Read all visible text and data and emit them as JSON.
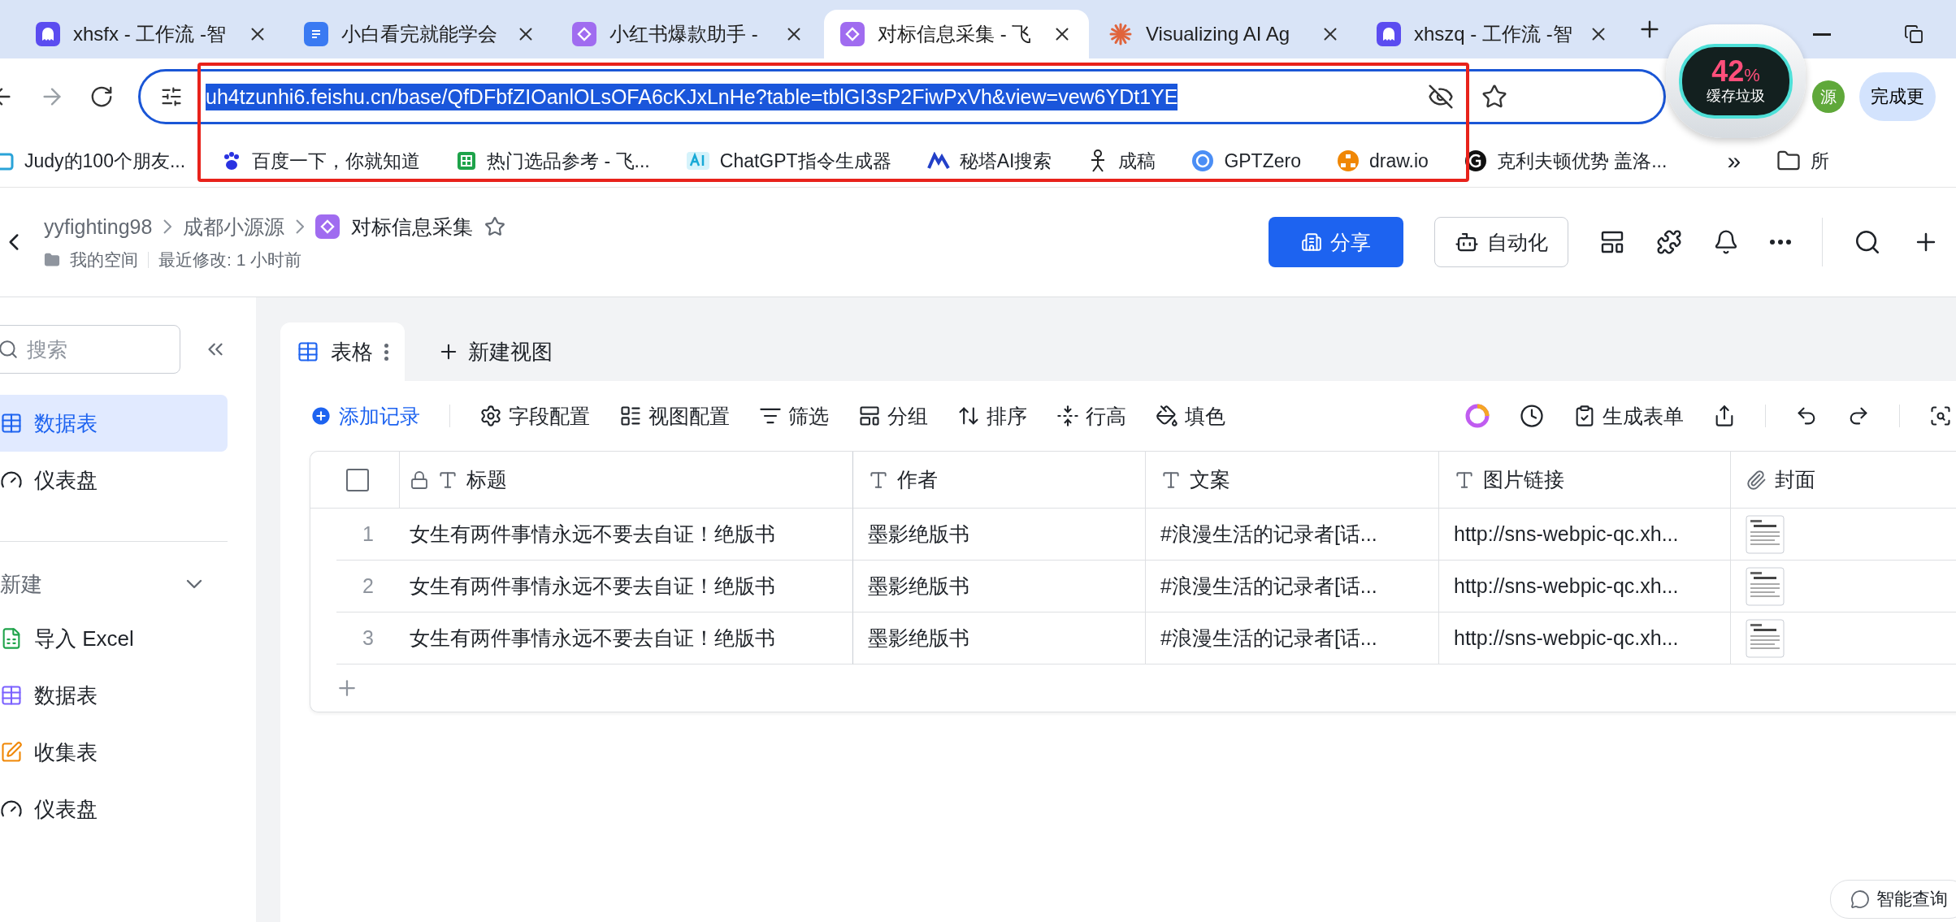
{
  "browser": {
    "tabs": [
      {
        "title": "xhsfx - 工作流 -智",
        "kind": "agent",
        "selected": false
      },
      {
        "title": "小白看完就能学会",
        "kind": "doc",
        "selected": false
      },
      {
        "title": "小红书爆款助手 -",
        "kind": "base",
        "selected": false
      },
      {
        "title": "对标信息采集 - 飞",
        "kind": "base",
        "selected": true
      },
      {
        "title": "Visualizing AI Ag",
        "kind": "burst",
        "selected": false
      },
      {
        "title": "xhszq - 工作流 -智",
        "kind": "agent",
        "selected": false
      }
    ],
    "url": "uh4tzunhi6.feishu.cn/base/QfDFbfZIOanlOLsOFA6cKJxLnHe?table=tblGI3sP2FiwPxVh&view=vew6YDt1YE",
    "url_selected": true,
    "profile": "源",
    "action_button": "完成更",
    "bookmarks": [
      {
        "label": "Judy的100个朋友...",
        "kind": "frame"
      },
      {
        "label": "百度一下，你就知道",
        "kind": "paw"
      },
      {
        "label": "热门选品参考 - 飞...",
        "kind": "sheet"
      },
      {
        "label": "ChatGPT指令生成器",
        "kind": "ai"
      },
      {
        "label": "秘塔AI搜索",
        "kind": "peak"
      },
      {
        "label": "成稿",
        "kind": "figure"
      },
      {
        "label": "GPTZero",
        "kind": "spiral"
      },
      {
        "label": "draw.io",
        "kind": "nodes"
      },
      {
        "label": "克利夫顿优势 盖洛...",
        "kind": "g"
      }
    ],
    "more_bookmarks": "»",
    "folder": "所"
  },
  "cleaner": {
    "percent": "42",
    "unit": "%",
    "label": "缓存垃圾"
  },
  "header": {
    "breadcrumb": [
      "yyfighting98",
      "成都小源源",
      "对标信息采集"
    ],
    "starred": false,
    "location": "我的空间",
    "modified": "最近修改: 1 小时前",
    "share": "分享",
    "automation": "自动化"
  },
  "sidebar": {
    "search_placeholder": "搜索",
    "items": [
      {
        "label": "数据表",
        "kind": "table",
        "selected": true
      },
      {
        "label": "仪表盘",
        "kind": "dashboard",
        "selected": false
      }
    ],
    "new_section": {
      "label": "新建",
      "expanded": true,
      "items": [
        {
          "label": "导入 Excel",
          "kind": "excel"
        },
        {
          "label": "数据表",
          "kind": "table"
        },
        {
          "label": "收集表",
          "kind": "form"
        },
        {
          "label": "仪表盘",
          "kind": "dashboard"
        }
      ]
    }
  },
  "views": [
    {
      "label": "表格",
      "selected": true
    }
  ],
  "add_view": "新建视图",
  "toolbar": {
    "add_record": "添加记录",
    "actions": [
      {
        "label": "字段配置",
        "kind": "settings"
      },
      {
        "label": "视图配置",
        "kind": "view"
      },
      {
        "label": "筛选",
        "kind": "filter"
      },
      {
        "label": "分组",
        "kind": "group"
      },
      {
        "label": "排序",
        "kind": "sort"
      },
      {
        "label": "行高",
        "kind": "height"
      },
      {
        "label": "填色",
        "kind": "fill"
      }
    ],
    "form": "生成表单"
  },
  "table": {
    "select_all": false,
    "columns": [
      {
        "label": "标题",
        "kind": "text",
        "locked": true
      },
      {
        "label": "作者",
        "kind": "text",
        "locked": false
      },
      {
        "label": "文案",
        "kind": "text",
        "locked": false
      },
      {
        "label": "图片链接",
        "kind": "text",
        "locked": false
      },
      {
        "label": "封面",
        "kind": "attachment",
        "locked": false
      }
    ],
    "rows": [
      {
        "index": "1",
        "cells": [
          "女生有两件事情永远不要去自证！绝版书",
          "墨影绝版书",
          "#浪漫生活的记录者[话...",
          "http://sns-webpic-qc.xh...",
          {
            "kind": "picture"
          }
        ]
      },
      {
        "index": "2",
        "cells": [
          "女生有两件事情永远不要去自证！绝版书",
          "墨影绝版书",
          "#浪漫生活的记录者[话...",
          "http://sns-webpic-qc.xh...",
          {
            "kind": "picture"
          }
        ]
      },
      {
        "index": "3",
        "cells": [
          "女生有两件事情永远不要去自证！绝版书",
          "墨影绝版书",
          "#浪漫生活的记录者[话...",
          "http://sns-webpic-qc.xh...",
          {
            "kind": "picture"
          }
        ]
      }
    ]
  },
  "assistant": "智能查询"
}
